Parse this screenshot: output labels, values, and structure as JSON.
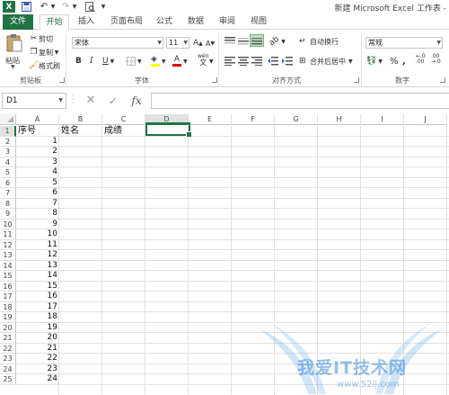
{
  "window_title": "新建 Microsoft Excel 工作表 -",
  "quick_access": {
    "logo": "X"
  },
  "tabs": [
    "文件",
    "开始",
    "插入",
    "页面布局",
    "公式",
    "数据",
    "审阅",
    "视图"
  ],
  "clipboard": {
    "paste": "粘贴",
    "cut": "剪切",
    "copy": "复制",
    "format_painter": "格式刷",
    "label": "剪贴板"
  },
  "font": {
    "name": "宋体",
    "size": "11",
    "label": "字体",
    "bold": "B",
    "italic": "I",
    "underline": "U",
    "grow": "A",
    "shrink": "A",
    "wen": "wén"
  },
  "alignment": {
    "wrap": "自动换行",
    "merge": "合并后居中",
    "label": "对齐方式"
  },
  "number": {
    "format": "常规",
    "label": "数字",
    "percent": "%",
    "comma": ","
  },
  "formula_bar": {
    "name_box": "D1",
    "fx": "fx"
  },
  "columns": [
    "A",
    "B",
    "C",
    "D",
    "E",
    "F",
    "G",
    "H",
    "I",
    "J"
  ],
  "selected_column": "D",
  "selected_row": "1",
  "rows": [
    "1",
    "2",
    "3",
    "4",
    "5",
    "6",
    "7",
    "8",
    "9",
    "10",
    "11",
    "12",
    "13",
    "14",
    "15",
    "16",
    "17",
    "18",
    "19",
    "20",
    "21",
    "22",
    "23",
    "24",
    "25"
  ],
  "headers": {
    "a1": "序号",
    "b1": "姓名",
    "c1": "成绩"
  },
  "a_values": [
    "1",
    "2",
    "3",
    "4",
    "5",
    "6",
    "7",
    "8",
    "9",
    "10",
    "11",
    "12",
    "13",
    "14",
    "15",
    "16",
    "17",
    "18",
    "19",
    "20",
    "21",
    "22",
    "23",
    "24"
  ],
  "watermark": {
    "text": "我爱IT技术网",
    "url": "www.52ij.com"
  },
  "colors": {
    "accent": "#217346",
    "grid": "#e1e1e1",
    "header_sel": "#e1e1e1"
  }
}
